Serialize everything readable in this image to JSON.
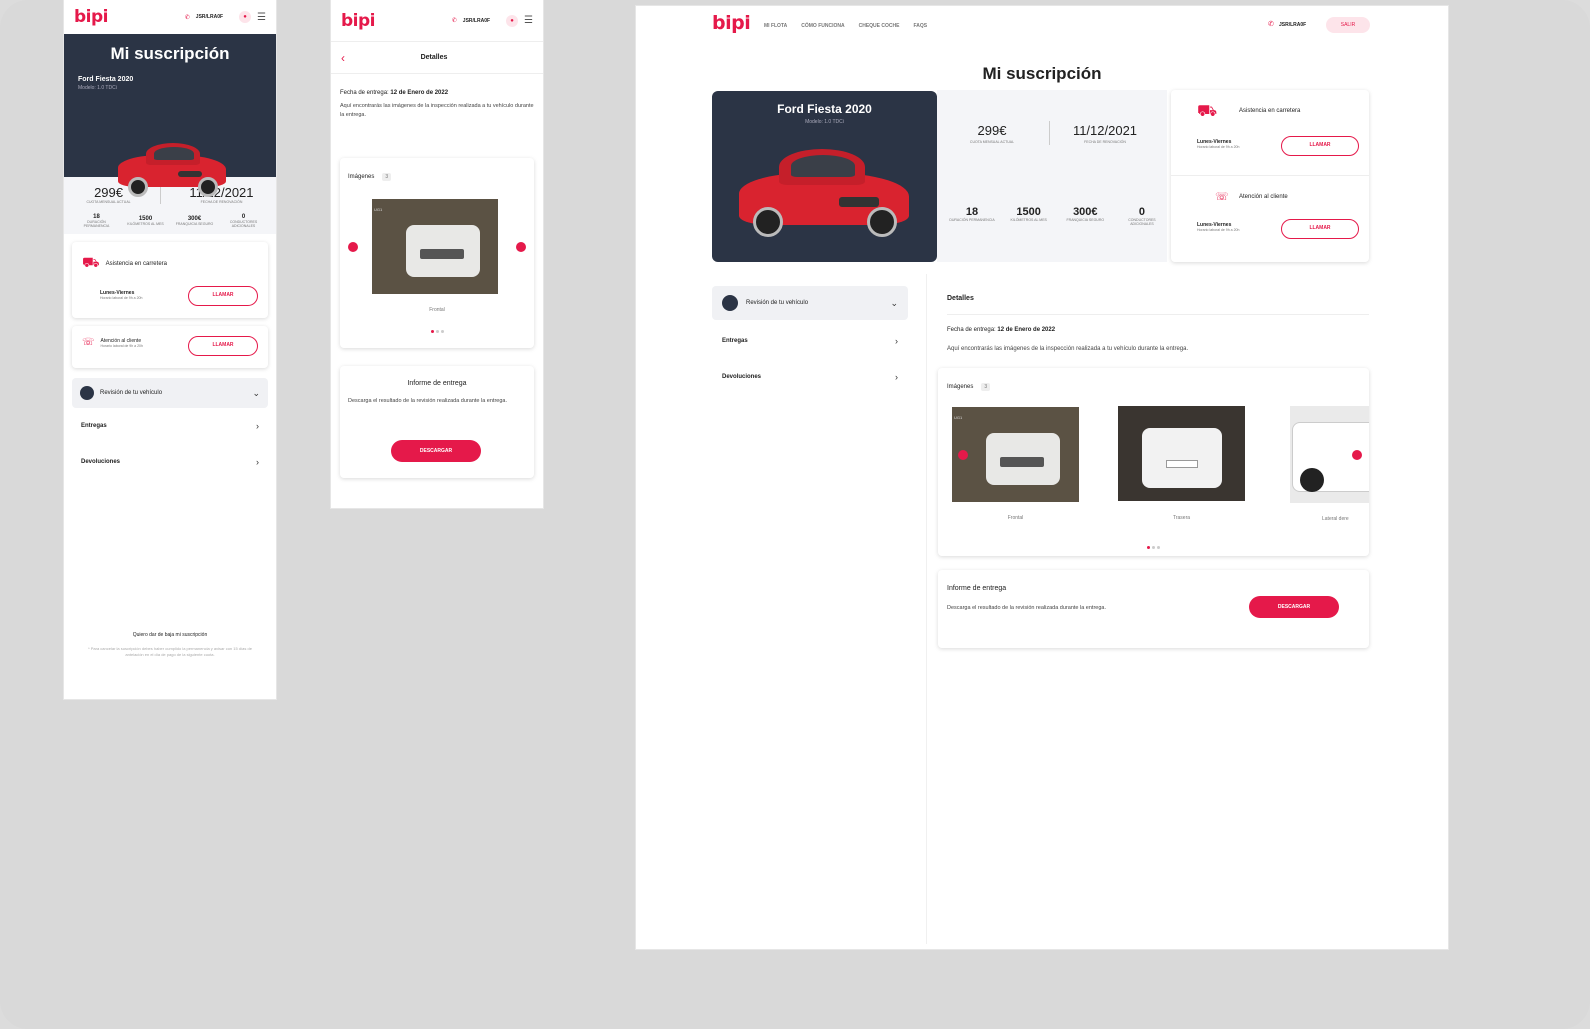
{
  "brand": {
    "logo": "bipi",
    "accent": "#e5194a",
    "dark": "#2b3445"
  },
  "header": {
    "phone": "JSR/LRA0F",
    "nav": [
      "MI FLOTA",
      "CÓMO FUNCIONA",
      "CHEQUE COCHE",
      "FAQS"
    ],
    "cta_label": "SALIR"
  },
  "subscription": {
    "title": "Mi suscripción",
    "car_name": "Ford Fiesta 2020",
    "car_model": "Modelo: 1.0 TDCi",
    "monthly_price": "299€",
    "monthly_caption": "CUOTA MENSUAL ACTUAL",
    "renewal_date": "11/12/2021",
    "renewal_caption": "FECHA DE RENOVACIÓN",
    "stats": [
      {
        "value": "18",
        "label": "DURACIÓN PERMANENCIA"
      },
      {
        "value": "1500",
        "label": "KILÓMETROS AL MES"
      },
      {
        "value": "300€",
        "label": "FRANQUICIA SEGURO"
      },
      {
        "value": "0",
        "label": "CONDUCTORES ADICIONALES"
      }
    ]
  },
  "services": [
    {
      "title": "Asistencia en carretera",
      "hours": "Lunes-Viernes",
      "hours_detail": "Horario laboral de 9h a 20h",
      "button": "LLAMAR"
    },
    {
      "title": "Atención al cliente",
      "hours": "Lunes-Viernes",
      "hours_detail": "Horario laboral de 9h a 20h",
      "button": "LLAMAR"
    }
  ],
  "menu": {
    "review_label": "Revisión de tu vehículo",
    "items": [
      "Entregas",
      "Devoluciones"
    ]
  },
  "details": {
    "back_title": "Detalles",
    "title": "Detalles",
    "delivery_prefix": "Fecha de entrega:",
    "delivery_date": "12 de Enero de 2022",
    "description": "Aquí encontrarás las imágenes de la inspección realizada a tu vehículo durante la entrega.",
    "images_title": "Imágenes",
    "images_count": "3",
    "image_stamp": "UG1",
    "images": [
      "Frontal",
      "Trasera",
      "Lateral dere"
    ],
    "report_title": "Informe de entrega",
    "report_text": "Descarga el resultado de la revisión realizada durante la entrega.",
    "report_button": "DESCARGAR"
  },
  "footer": {
    "unsubscribe": "Quiero dar de baja mi suscripción",
    "note": "* Para cancelar la suscripción debes haber cumplido la permanencia y avisar con 15 días de antelación en el día de pago de la siguiente cuota."
  }
}
